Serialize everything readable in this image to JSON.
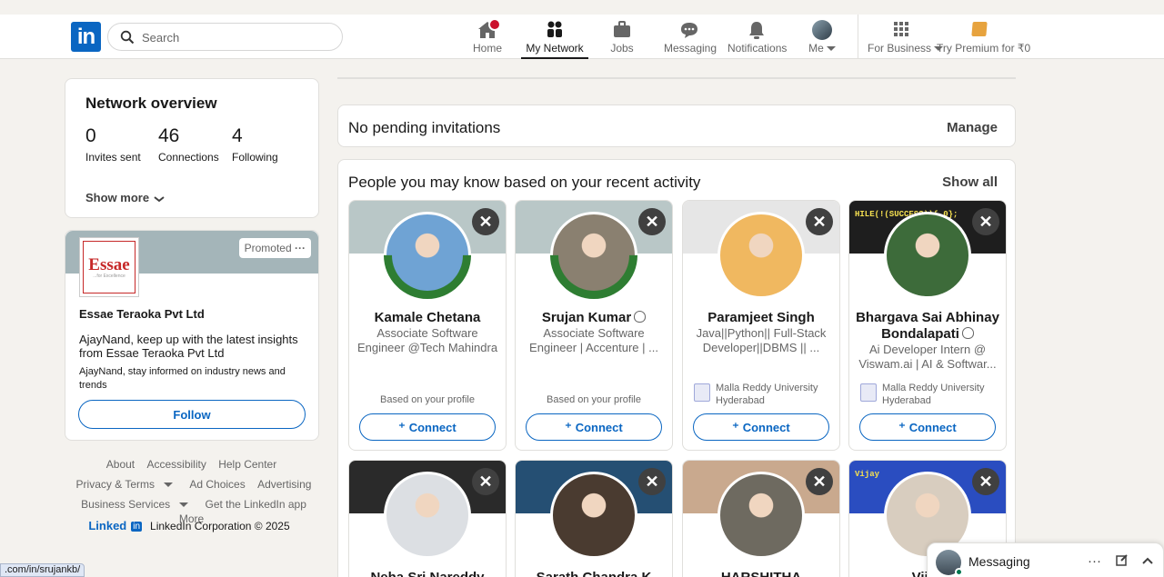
{
  "nav": {
    "search_placeholder": "Search",
    "items": [
      {
        "label": "Home",
        "icon": "home-icon"
      },
      {
        "label": "My Network",
        "icon": "network-icon"
      },
      {
        "label": "Jobs",
        "icon": "briefcase-icon"
      },
      {
        "label": "Messaging",
        "icon": "chat-icon"
      },
      {
        "label": "Notifications",
        "icon": "bell-icon"
      },
      {
        "label": "Me",
        "icon": "avatar"
      }
    ],
    "for_business": "For Business",
    "premium": "Try Premium for ₹0"
  },
  "network_overview": {
    "title": "Network overview",
    "stats": [
      {
        "value": "0",
        "label": "Invites sent"
      },
      {
        "value": "46",
        "label": "Connections"
      },
      {
        "value": "4",
        "label": "Following"
      }
    ],
    "show_more": "Show more"
  },
  "ad": {
    "promoted": "Promoted",
    "logo_text": "Essae",
    "logo_tagline": "...for Excellence",
    "company": "Essae Teraoka Pvt Ltd",
    "headline": "AjayNand, keep up with the latest insights from Essae Teraoka Pvt Ltd",
    "subtext": "AjayNand, stay informed on industry news and trends",
    "follow": "Follow"
  },
  "footer": {
    "row1": [
      "About",
      "Accessibility",
      "Help Center"
    ],
    "row2": [
      "Privacy & Terms",
      "Ad Choices",
      "Advertising"
    ],
    "row3": [
      "Business Services",
      "Get the LinkedIn app",
      "More"
    ],
    "brand": "Linked",
    "brand_in": "in",
    "copyright": "LinkedIn Corporation © 2025"
  },
  "pending": {
    "title": "No pending invitations",
    "manage": "Manage"
  },
  "pymk": {
    "title": "People you may know based on your recent activity",
    "show_all": "Show all",
    "connect_label": "Connect",
    "people": [
      {
        "name": "Kamale Chetana",
        "desc": "Associate Software Engineer @Tech Mahindra",
        "footer": "Based on your profile",
        "banner": "#b9c7c7",
        "avatar": "#6fa3d4",
        "otw": true
      },
      {
        "name": "Srujan Kumar",
        "desc": "Associate Software Engineer | Accenture | ...",
        "footer": "Based on your profile",
        "banner": "#b9c7c7",
        "avatar": "#8a8070",
        "otw": true,
        "verified": true
      },
      {
        "name": "Paramjeet Singh",
        "desc": "Java||Python|| Full-Stack Developer||DBMS || ...",
        "uni": "Malla Reddy University Hyderabad",
        "banner": "#e6e6e6",
        "avatar": "#f0b860"
      },
      {
        "name": "Bhargava Sai Abhinay Bondalapati",
        "desc": "Ai Developer Intern @ Viswam.ai | AI & Softwar...",
        "uni": "Malla Reddy University Hyderabad",
        "banner": "#1e1e1e",
        "avatar": "#3d6b3a",
        "verified": true,
        "banner_text": "HILE(!(SUCCESS)){ 0};"
      },
      {
        "name": "Neha Sri Nareddy",
        "banner": "#2a2a2a",
        "avatar": "#dcdfe3"
      },
      {
        "name": "Sarath Chandra K",
        "banner": "#254f73",
        "avatar": "#4a3b30"
      },
      {
        "name": "HARSHITHA GUJJALA",
        "banner": "#c9a98e",
        "avatar": "#6e6a60"
      },
      {
        "name": "Vijay",
        "banner": "#2a4dc0",
        "avatar": "#d8cdbf",
        "banner_text": "Vijay"
      }
    ]
  },
  "messaging": {
    "label": "Messaging"
  },
  "statusbar": {
    "url": ".com/in/srujankb/"
  }
}
